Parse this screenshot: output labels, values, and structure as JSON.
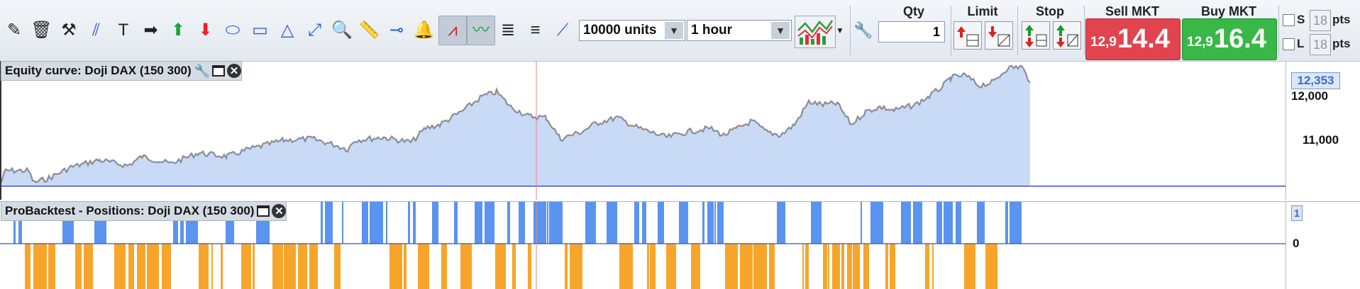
{
  "toolbar": {
    "tools": [
      {
        "name": "pen-tool-icon",
        "glyph": "✎"
      },
      {
        "name": "trash-icon",
        "glyph": "🗑"
      },
      {
        "name": "tools-icon",
        "glyph": "⚒"
      },
      {
        "name": "parallel-lines-icon",
        "glyph": "⫽"
      },
      {
        "name": "text-tool-icon",
        "glyph": "T"
      },
      {
        "name": "arrow-right-icon",
        "glyph": "➡"
      },
      {
        "name": "arrow-up-icon",
        "glyph": "⬆"
      },
      {
        "name": "arrow-down-icon",
        "glyph": "⬇"
      },
      {
        "name": "ellipse-tool-icon",
        "glyph": "⬭"
      },
      {
        "name": "rectangle-tool-icon",
        "glyph": "▭"
      },
      {
        "name": "triangle-tool-icon",
        "glyph": "△"
      },
      {
        "name": "line-points-icon",
        "glyph": "⤢"
      },
      {
        "name": "zoom-icon",
        "glyph": "🔍"
      },
      {
        "name": "ruler-icon",
        "glyph": "📏"
      },
      {
        "name": "horizontal-line-icon",
        "glyph": "⊸"
      },
      {
        "name": "alert-bell-icon",
        "glyph": "🔔"
      },
      {
        "name": "trend-channel-red-icon",
        "glyph": "⩘"
      },
      {
        "name": "trend-line-green-icon",
        "glyph": "〰"
      },
      {
        "name": "fibonacci-icon",
        "glyph": "≣"
      },
      {
        "name": "fibonacci-fan-icon",
        "glyph": "≡"
      },
      {
        "name": "diagonal-line-icon",
        "glyph": "⟋"
      }
    ],
    "units_select": "10000 units",
    "timeframe_select": "1 hour",
    "indicators_icon": "indicators-icon",
    "wrench_icon": "wrench-icon"
  },
  "order": {
    "qty_label": "Qty",
    "qty_value": "1",
    "limit_label": "Limit",
    "stop_label": "Stop",
    "sell_label": "Sell MKT",
    "sell_prefix": "12,9",
    "sell_price": "14.4",
    "buy_label": "Buy MKT",
    "buy_prefix": "12,9",
    "buy_price": "16.4",
    "s_label": "S",
    "l_label": "L",
    "s_pts_value": "18",
    "l_pts_value": "18",
    "pts_label": "pts"
  },
  "equity_panel": {
    "title": "Equity curve: Doji DAX (150 300)",
    "price_tag": "12,353",
    "axis_labels": [
      "12,000",
      "11,000"
    ]
  },
  "positions_panel": {
    "title": "ProBacktest - Positions: Doji DAX (150 300)",
    "side_tag": "1",
    "zero_label": "0"
  },
  "colors": {
    "curve_fill": "#c9daf7",
    "curve_line": "#5b8fdc",
    "curve_accent": "#f29d2c",
    "long_bar": "#5b93f0",
    "short_bar": "#f7a52a",
    "sell": "#e2444f",
    "buy": "#38b847"
  }
}
